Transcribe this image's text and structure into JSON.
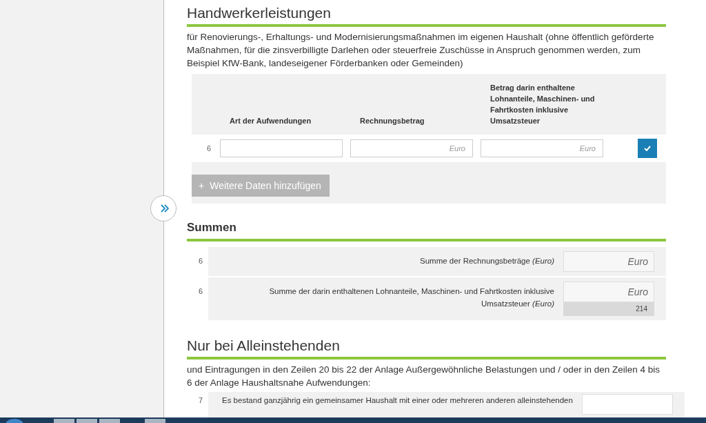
{
  "sections": [
    {
      "kind": "table",
      "title": "Handwerkerleistungen",
      "description": "für Renovierungs-, Erhaltungs- und Modernisierungsmaßnahmen im eigenen Haushalt (ohne öffentlich geförderte Maßnahmen, für die zinsverbilligte Darlehen oder steuerfreie Zuschüsse in Anspruch genommen werden, zum Beispiel KfW-Bank, landeseigener Förderbanken oder Gemeinden)",
      "columns": [
        "Art der Aufwendungen",
        "Rechnungsbetrag",
        "Betrag darin enthaltene Lohnanteile, Maschinen- und Fahrtkosten inklusive Umsatzsteuer"
      ],
      "rows": [
        {
          "line": "6",
          "fields": [
            {
              "kind": "text"
            },
            {
              "kind": "amount",
              "placeholder": "Euro"
            },
            {
              "kind": "amount",
              "placeholder": "Euro"
            }
          ],
          "checked": true
        }
      ],
      "add_button": {
        "icon": "+",
        "label": "Weitere Daten hinzufügen",
        "disabled": true
      }
    },
    {
      "kind": "sums",
      "title": "Summen",
      "rows": [
        {
          "line": "6",
          "label": "Summe der Rechnungsbeträge *(Euro)*",
          "placeholder": "Euro"
        },
        {
          "line": "6",
          "label": "Summe der darin enthaltenen Lohnanteile, Maschinen- und Fahrtkosten inklusive Umsatzsteuer *(Euro)*",
          "placeholder": "Euro",
          "code": "214"
        }
      ]
    },
    {
      "kind": "sums",
      "title": "Nur bei Alleinstehenden",
      "description": "und Eintragungen in den Zeilen 20 bis 22 der Anlage Außergewöhnliche Belastungen und / oder in den Zeilen 4 bis 6 der Anlage Haushaltsnahe Aufwendungen:",
      "rows": [
        {
          "line": "7",
          "label": "Es bestand ganzjährig ein gemeinsamer Haushalt mit einer oder mehreren anderen alleinstehenden"
        }
      ]
    }
  ]
}
